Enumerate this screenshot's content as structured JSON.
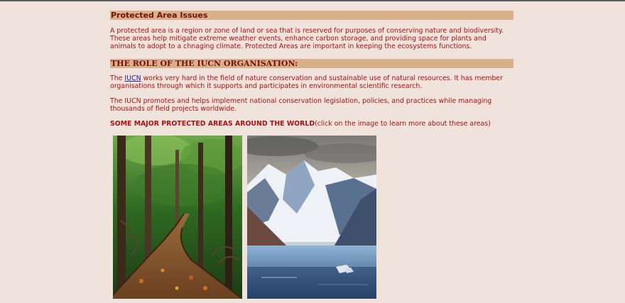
{
  "section1": {
    "title": "Protected Area Issues",
    "paragraph": "A protected area is a region or zone of land or sea that is reserved for purposes of conserving nature and biodiversity. These areas help mitigate extreme weather events, enhance carbon storage, and providing space for plants and animals to adopt to a chnaging climate. Protected Areas are important in keeping the ecosystems functions."
  },
  "section2": {
    "title": "THE ROLE OF THE IUCN ORGANISATION:",
    "p1_prefix": "The ",
    "p1_link": "IUCN",
    "p1_suffix": " works very hard in the field of nature conservation and sustainable use of natural resources. It has member organisations through which it supports and participates in environmental scientific research.",
    "p2": "The IUCN promotes and helps implement national conservation legislation, policies, and practices while managing thousands of field projects worldwide."
  },
  "section3": {
    "heading_bold": "SOME MAJOR PROTECTED AREAS AROUND THE WORLD",
    "heading_note": "(click on the image to learn more about these areas)"
  },
  "gallery": {
    "images": [
      {
        "name": "mangrove-forest-boardwalk"
      },
      {
        "name": "mountain-fjord-glacier"
      }
    ]
  },
  "colors": {
    "background": "#efe3dc",
    "heading_bar": "#d8b08a",
    "text": "#b01010",
    "link": "#1a1aaa"
  }
}
